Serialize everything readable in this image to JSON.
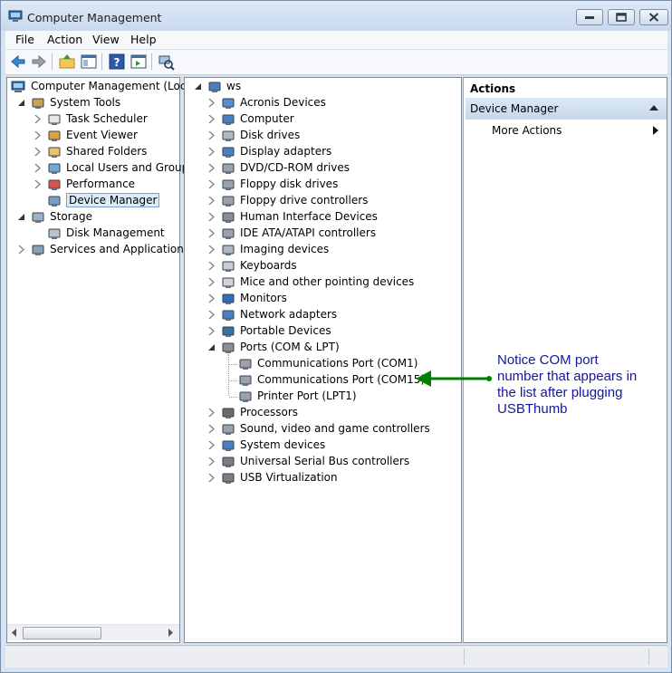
{
  "window": {
    "title": "Computer Management"
  },
  "menu": [
    "File",
    "Action",
    "View",
    "Help"
  ],
  "toolbar": {
    "icons": [
      "back-arrow-icon",
      "forward-arrow-icon",
      "up-folder-icon",
      "show-hide-tree-icon",
      "help-icon",
      "show-hide-action-pane-icon",
      "scan-hardware-icon"
    ]
  },
  "left_tree": {
    "root": "Computer Management (Local",
    "items": [
      {
        "label": "System Tools",
        "icon": "tools-icon"
      },
      {
        "label": "Task Scheduler",
        "icon": "clock-icon"
      },
      {
        "label": "Event Viewer",
        "icon": "event-viewer-icon"
      },
      {
        "label": "Shared Folders",
        "icon": "shared-folder-icon"
      },
      {
        "label": "Local Users and Groups",
        "icon": "users-icon"
      },
      {
        "label": "Performance",
        "icon": "performance-icon"
      },
      {
        "label": "Device Manager",
        "icon": "device-manager-icon"
      },
      {
        "label": "Storage",
        "icon": "storage-icon"
      },
      {
        "label": "Disk Management",
        "icon": "disk-icon"
      },
      {
        "label": "Services and Applications",
        "icon": "services-icon"
      }
    ],
    "selected": "Device Manager"
  },
  "device_tree": {
    "root": "ws",
    "items": [
      "Acronis Devices",
      "Computer",
      "Disk drives",
      "Display adapters",
      "DVD/CD-ROM drives",
      "Floppy disk drives",
      "Floppy drive controllers",
      "Human Interface Devices",
      "IDE ATA/ATAPI controllers",
      "Imaging devices",
      "Keyboards",
      "Mice and other pointing devices",
      "Monitors",
      "Network adapters",
      "Portable Devices",
      "Ports (COM & LPT)"
    ],
    "ports_children": [
      "Communications Port (COM1)",
      "Communications Port (COM15)",
      "Printer Port (LPT1)"
    ],
    "items_after": [
      "Processors",
      "Sound, video and game controllers",
      "System devices",
      "Universal Serial Bus controllers",
      "USB Virtualization"
    ]
  },
  "actions": {
    "header": "Actions",
    "section": "Device Manager",
    "items": [
      "More Actions"
    ]
  },
  "annotation": {
    "lines": [
      "Notice COM port",
      "number that appears in",
      "the list after plugging",
      "USBThumb"
    ],
    "color": "#008000"
  }
}
